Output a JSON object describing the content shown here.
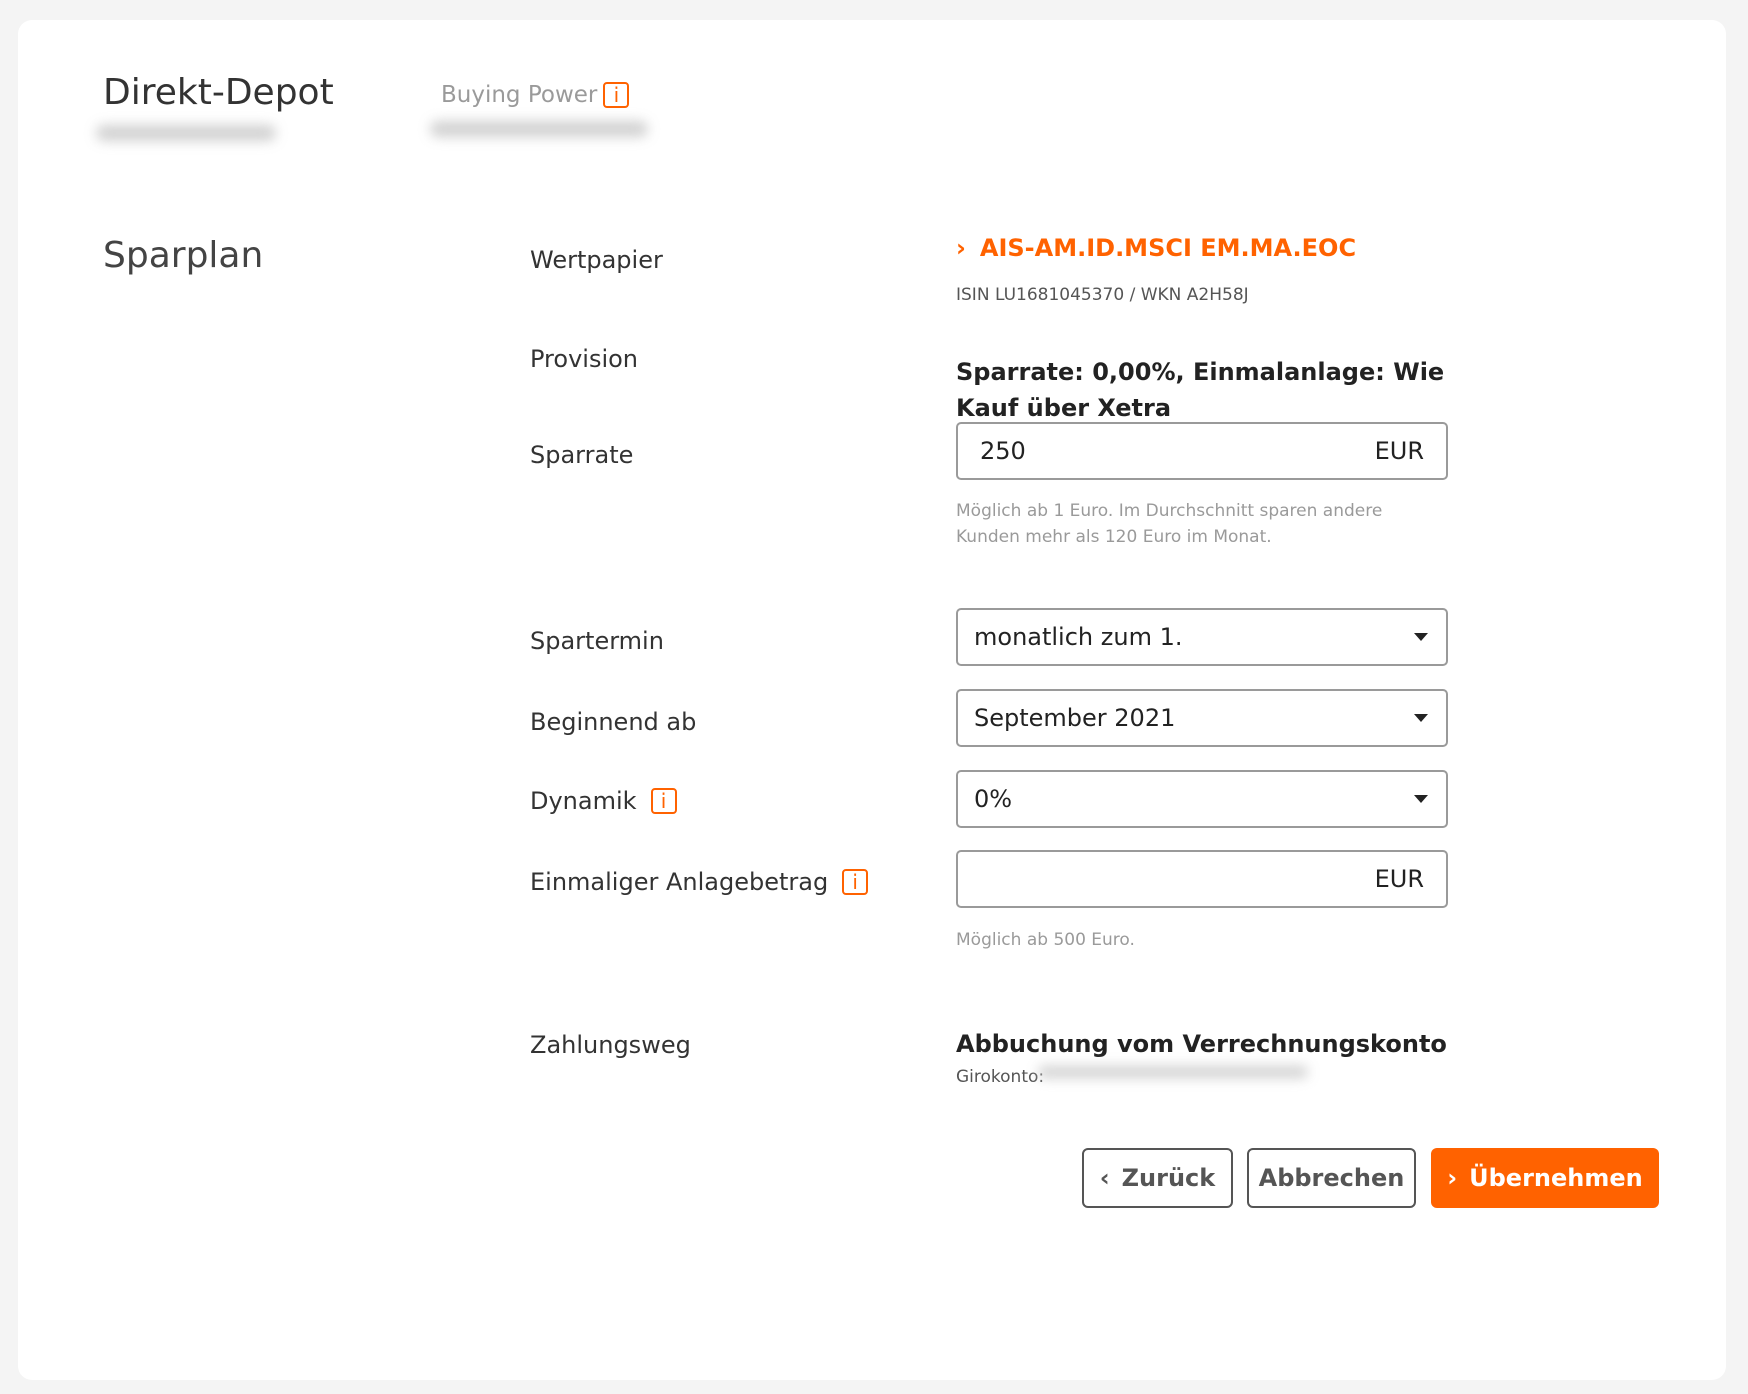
{
  "header": {
    "title": "Direkt-Depot",
    "buying_power_label": "Buying Power",
    "info_glyph": "i"
  },
  "section": {
    "title": "Sparplan"
  },
  "form": {
    "security": {
      "label": "Wertpapier",
      "link_arrow": "›",
      "name": "AIS-AM.ID.MSCI EM.MA.EOC",
      "isin_wkn": "ISIN LU1681045370 / WKN A2H58J"
    },
    "provision": {
      "label": "Provision",
      "value": "Sparrate: 0,00%, Einmalanlage: Wie Kauf über Xetra"
    },
    "sparrate": {
      "label": "Sparrate",
      "value": "250",
      "currency": "EUR",
      "hint": "Möglich ab 1 Euro. Im Durchschnitt sparen andere Kunden mehr als 120 Euro im Monat."
    },
    "spartermin": {
      "label": "Spartermin",
      "selected": "monatlich zum 1."
    },
    "beginnend_ab": {
      "label": "Beginnend ab",
      "selected": "September 2021"
    },
    "dynamik": {
      "label": "Dynamik",
      "selected": "0%"
    },
    "einmalanlage": {
      "label": "Einmaliger Anlagebetrag",
      "value": "",
      "currency": "EUR",
      "hint": "Möglich ab 500 Euro."
    },
    "zahlungsweg": {
      "label": "Zahlungsweg",
      "value": "Abbuchung vom Verrechnungskonto",
      "account_label": "Girokonto:"
    }
  },
  "buttons": {
    "back_arrow": "‹",
    "back": "Zurück",
    "cancel": "Abbrechen",
    "submit_arrow": "›",
    "submit": "Übernehmen"
  },
  "colors": {
    "accent": "#ff6200",
    "background": "#f4f4f4",
    "card": "#ffffff",
    "hint_text": "#9a9a9a"
  },
  "icons": {
    "info": "info-icon",
    "caret": "caret-down-icon",
    "chevron_right": "chevron-right-icon",
    "chevron_left": "chevron-left-icon"
  }
}
